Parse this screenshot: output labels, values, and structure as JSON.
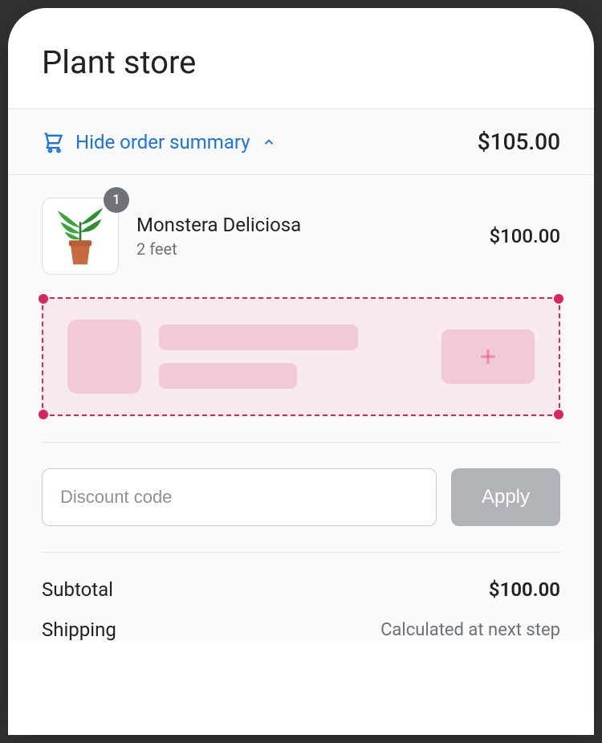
{
  "header": {
    "title": "Plant store"
  },
  "summary": {
    "toggle_label": "Hide order summary",
    "total": "$105.00"
  },
  "line_item": {
    "quantity": "1",
    "name": "Monstera Deliciosa",
    "variant": "2 feet",
    "price": "$100.00"
  },
  "discount": {
    "placeholder": "Discount code",
    "apply_label": "Apply"
  },
  "totals": {
    "subtotal_label": "Subtotal",
    "subtotal_value": "$100.00",
    "shipping_label": "Shipping",
    "shipping_value": "Calculated at next step"
  },
  "colors": {
    "link": "#1a73e8",
    "placeholder_accent": "#d72660"
  }
}
